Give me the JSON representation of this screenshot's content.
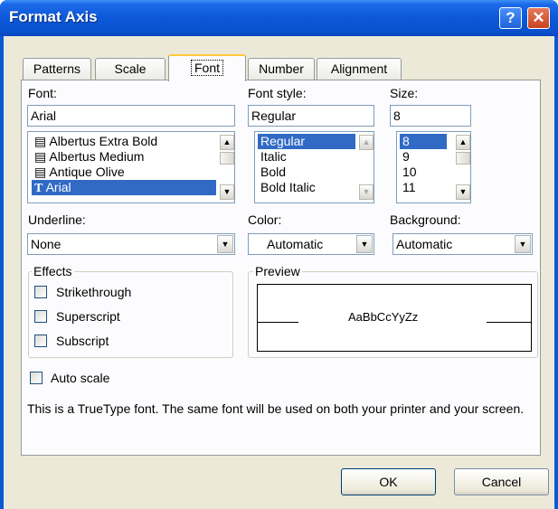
{
  "window": {
    "title": "Format Axis",
    "help_glyph": "?",
    "close_glyph": "✕"
  },
  "tabs": [
    "Patterns",
    "Scale",
    "Font",
    "Number",
    "Alignment"
  ],
  "active_tab": "Font",
  "font": {
    "label": "Font:",
    "value": "Arial",
    "list": [
      {
        "name": "Albertus Extra Bold",
        "icon": "printer-font-icon"
      },
      {
        "name": "Albertus Medium",
        "icon": "printer-font-icon"
      },
      {
        "name": "Antique Olive",
        "icon": "printer-font-icon"
      },
      {
        "name": "Arial",
        "icon": "truetype-font-icon",
        "selected": true
      }
    ]
  },
  "font_style": {
    "label": "Font style:",
    "value": "Regular",
    "list": [
      "Regular",
      "Italic",
      "Bold",
      "Bold Italic"
    ],
    "selected": "Regular"
  },
  "size": {
    "label": "Size:",
    "value": "8",
    "list": [
      "8",
      "9",
      "10",
      "11"
    ],
    "selected": "8"
  },
  "underline": {
    "label": "Underline:",
    "value": "None"
  },
  "color": {
    "label": "Color:",
    "value": "Automatic"
  },
  "background": {
    "label": "Background:",
    "value": "Automatic"
  },
  "effects": {
    "label": "Effects",
    "strikethrough": "Strikethrough",
    "superscript": "Superscript",
    "subscript": "Subscript"
  },
  "preview": {
    "label": "Preview",
    "sample": "AaBbCcYyZz"
  },
  "auto_scale": {
    "label": "Auto scale",
    "checked": false
  },
  "info_text": "This is a TrueType font.  The same font will be used on both your printer and your screen.",
  "buttons": {
    "ok": "OK",
    "cancel": "Cancel"
  },
  "colors": {
    "titlebar": "#0a52cf",
    "selection": "#316ac5",
    "dialog_bg": "#ece9d8",
    "active_tab_accent": "#ffc83c"
  }
}
